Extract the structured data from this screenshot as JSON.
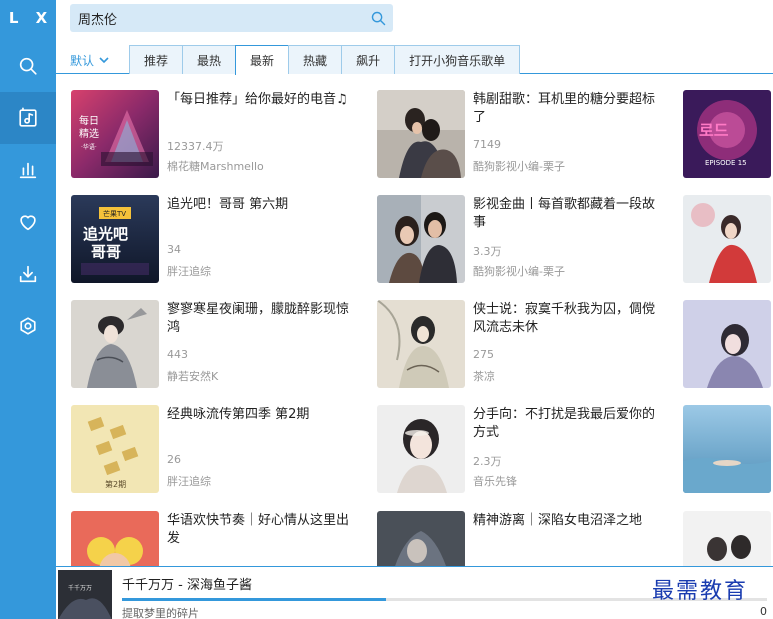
{
  "app": {
    "logo": "L X"
  },
  "sidebar": {
    "items": [
      {
        "icon": "search-icon",
        "active": false
      },
      {
        "icon": "music-list-icon",
        "active": true
      },
      {
        "icon": "chart-icon",
        "active": false
      },
      {
        "icon": "heart-icon",
        "active": false
      },
      {
        "icon": "download-icon",
        "active": false
      },
      {
        "icon": "settings-icon",
        "active": false
      }
    ]
  },
  "search": {
    "value": "周杰伦"
  },
  "source": {
    "label": "默认"
  },
  "tabs": [
    {
      "label": "推荐"
    },
    {
      "label": "最热"
    },
    {
      "label": "最新"
    },
    {
      "label": "热藏"
    },
    {
      "label": "飙升"
    },
    {
      "label": "打开小狗音乐歌单"
    }
  ],
  "active_tab": "最新",
  "playlists": [
    {
      "title": "「每日推荐」给你最好的电音♫",
      "count": "12337.4万",
      "author": "棉花糖Marshmello"
    },
    {
      "title": "韩剧甜歌：耳机里的糖分要超标了",
      "count": "7149",
      "author": "酷狗影视小编-栗子"
    },
    {
      "title": "",
      "count": "",
      "author": ""
    },
    {
      "title": "追光吧！哥哥 第六期",
      "count": "34",
      "author": "胖汪追综"
    },
    {
      "title": "影视金曲丨每首歌都藏着一段故事",
      "count": "3.3万",
      "author": "酷狗影视小编-栗子"
    },
    {
      "title": "",
      "count": "",
      "author": ""
    },
    {
      "title": "寥寥寒星夜阑珊，朦胧醉影现惊鸿",
      "count": "443",
      "author": "静若安然K"
    },
    {
      "title": "侠士说：寂寞千秋我为囚，倜傥风流志未休",
      "count": "275",
      "author": "茶凉"
    },
    {
      "title": "",
      "count": "",
      "author": ""
    },
    {
      "title": "经典咏流传第四季 第2期",
      "count": "26",
      "author": "胖汪追综"
    },
    {
      "title": "分手向：不打扰是我最后爱你的方式",
      "count": "2.3万",
      "author": "音乐先锋"
    },
    {
      "title": "",
      "count": "",
      "author": ""
    },
    {
      "title": "华语欢快节奏｜好心情从这里出发",
      "count": "",
      "author": ""
    },
    {
      "title": "精神游离｜深陷女电沼泽之地",
      "count": "",
      "author": ""
    },
    {
      "title": "",
      "count": "",
      "author": ""
    }
  ],
  "thumb_texts": {
    "daily": "每日\n精选",
    "daily_sub": "·华语·",
    "variety_tag": "芒果TV",
    "variety_title": "追光吧\n哥哥",
    "kpop": "EPISODE 15",
    "poem_mark": "第2期"
  },
  "player": {
    "song": "千千万万 - 深海鱼子酱",
    "lyric": "提取梦里的碎片",
    "time": "0",
    "progress": 0.41
  },
  "watermark": "最需教育",
  "colors": {
    "accent": "#3498db",
    "sidebar": "#3498db",
    "sidebar_active": "#2c86c6"
  }
}
